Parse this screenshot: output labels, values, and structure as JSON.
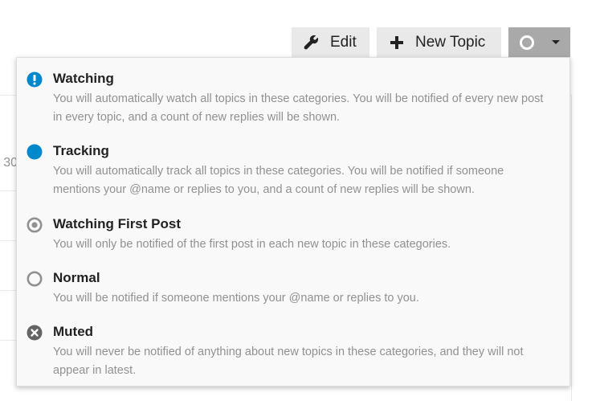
{
  "toolbar": {
    "edit_label": "Edit",
    "new_topic_label": "New Topic"
  },
  "background": {
    "partial_text": "30"
  },
  "notification_menu": {
    "items": [
      {
        "title": "Watching",
        "description": "You will automatically watch all topics in these categories. You will be notified of every new post in every topic, and a count of new replies will be shown.",
        "icon": "exclamation-circle-icon"
      },
      {
        "title": "Tracking",
        "description": "You will automatically track all topics in these categories. You will be notified if someone mentions your @name or replies to you, and a count of new replies will be shown.",
        "icon": "filled-circle-icon"
      },
      {
        "title": "Watching First Post",
        "description": "You will only be notified of the first post in each new topic in these categories.",
        "icon": "dot-circle-icon"
      },
      {
        "title": "Normal",
        "description": "You will be notified if someone mentions your @name or replies to you.",
        "icon": "empty-circle-icon"
      },
      {
        "title": "Muted",
        "description": "You will never be notified of anything about new topics in these categories, and they will not appear in latest.",
        "icon": "times-circle-icon"
      }
    ]
  },
  "colors": {
    "watching_icon": "#0088cc",
    "tracking_icon": "#0088cc",
    "muted_icon": "#646464",
    "secondary_text": "#919191",
    "menu_background": "#f9f9f9",
    "button_background": "#e9e9e9",
    "notify_button_background": "#a9a9a9"
  }
}
